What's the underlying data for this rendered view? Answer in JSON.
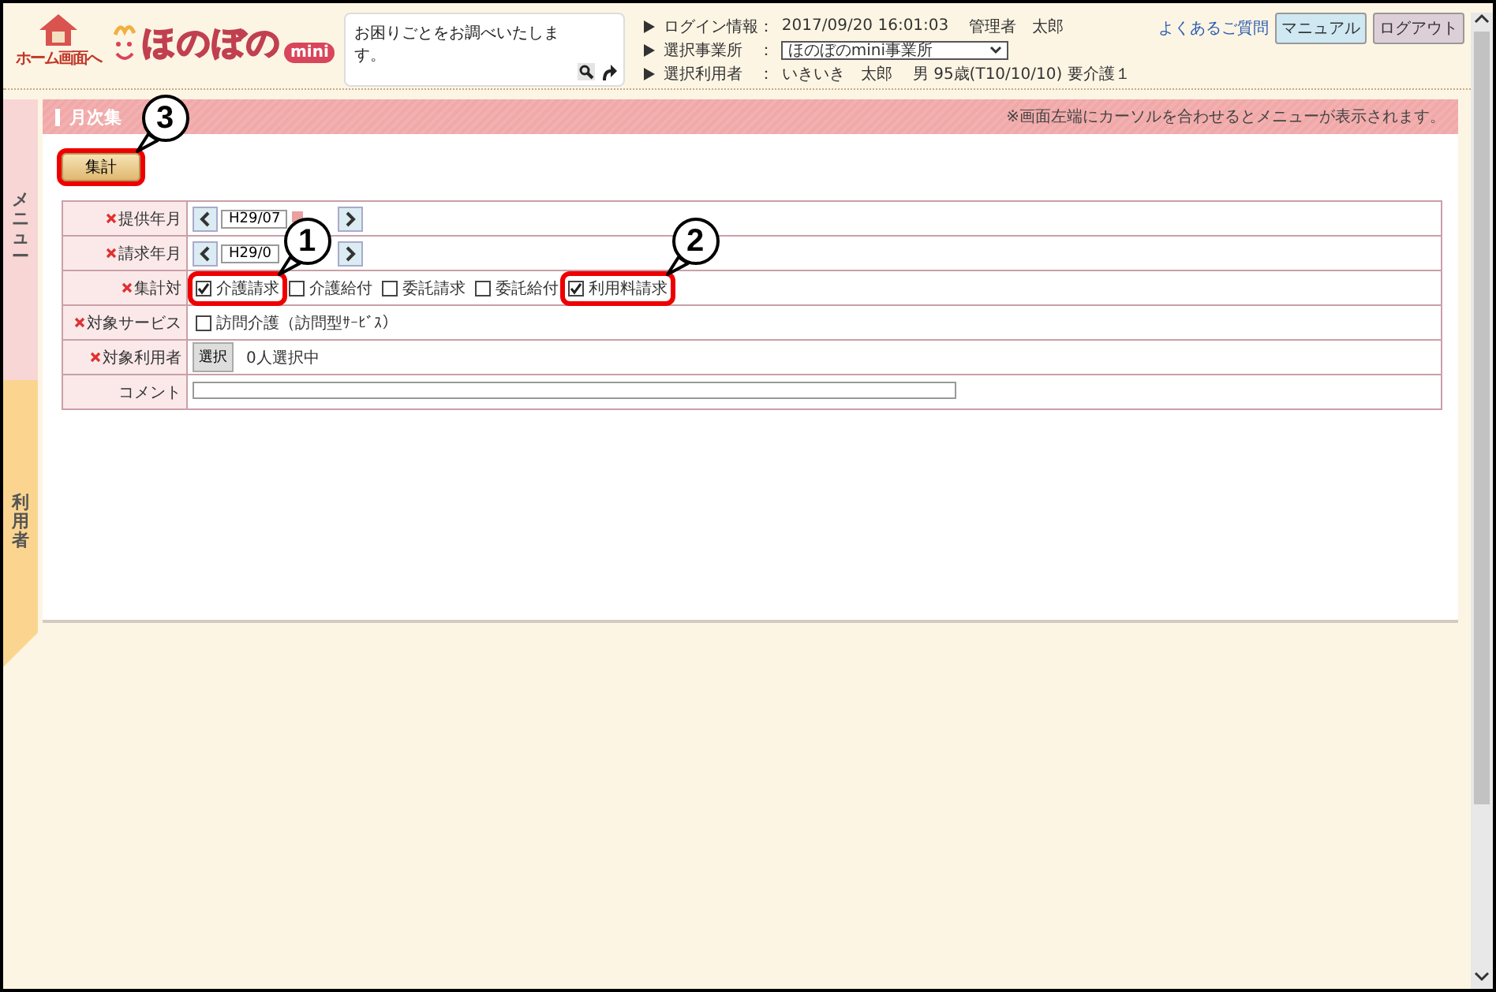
{
  "header": {
    "home_label": "ホーム画面へ",
    "logo_text": "ほのぼの",
    "logo_badge": "mini",
    "search_placeholder": "お困りごとをお調べいたします。",
    "info": [
      {
        "kind": "text",
        "label": "ログイン情報：",
        "values": [
          "2017/09/20 16:01:03",
          "管理者　太郎"
        ]
      },
      {
        "kind": "select",
        "label": "選択事業所　：",
        "value": "ほのぼのmini事業所"
      },
      {
        "kind": "text",
        "label": "選択利用者　：",
        "values": [
          "いきいき　太郎",
          "男 95歳(T10/10/10) 要介護１"
        ]
      }
    ],
    "links": [
      {
        "kind": "link",
        "label": "よくあるご質問"
      },
      {
        "kind": "manual",
        "label": "マニュアル"
      },
      {
        "kind": "logout",
        "label": "ログアウト"
      }
    ]
  },
  "sidebar": {
    "tabs": [
      {
        "kind": "menu",
        "label": "メニュー"
      },
      {
        "kind": "user",
        "label": "利用者"
      }
    ]
  },
  "panel": {
    "title": "月次集",
    "notice": "※画面左端にカーソルを合わせるとメニューが表示されます。",
    "action_button": {
      "label": "集計",
      "highlighted": true,
      "callout": "3"
    },
    "form": {
      "rows": [
        {
          "kind": "month",
          "label": "提供年月",
          "required": true,
          "value": "H29/07",
          "calendar": true
        },
        {
          "kind": "month",
          "label": "請求年月",
          "required": true,
          "value": "H29/0",
          "calendar": false
        },
        {
          "kind": "checks",
          "label": "集計対",
          "required": true,
          "options": [
            {
              "label": "介護請求",
              "checked": true,
              "highlighted": true,
              "callout": "1"
            },
            {
              "label": "介護給付",
              "checked": false,
              "highlighted": false
            },
            {
              "label": "委託請求",
              "checked": false,
              "highlighted": false
            },
            {
              "label": "委託給付",
              "checked": false,
              "highlighted": false
            },
            {
              "label": "利用料請求",
              "checked": true,
              "highlighted": true,
              "callout": "2"
            }
          ]
        },
        {
          "kind": "checks",
          "label": "対象サービス",
          "required": true,
          "options": [
            {
              "label": "訪問介護（訪問型ｻｰﾋﾞｽ）",
              "checked": false,
              "highlighted": false
            }
          ]
        },
        {
          "kind": "picker",
          "label": "対象利用者",
          "required": true,
          "button": "選択",
          "value": "0人選択中"
        },
        {
          "kind": "comment",
          "label": "コメント",
          "required": false
        }
      ]
    }
  }
}
